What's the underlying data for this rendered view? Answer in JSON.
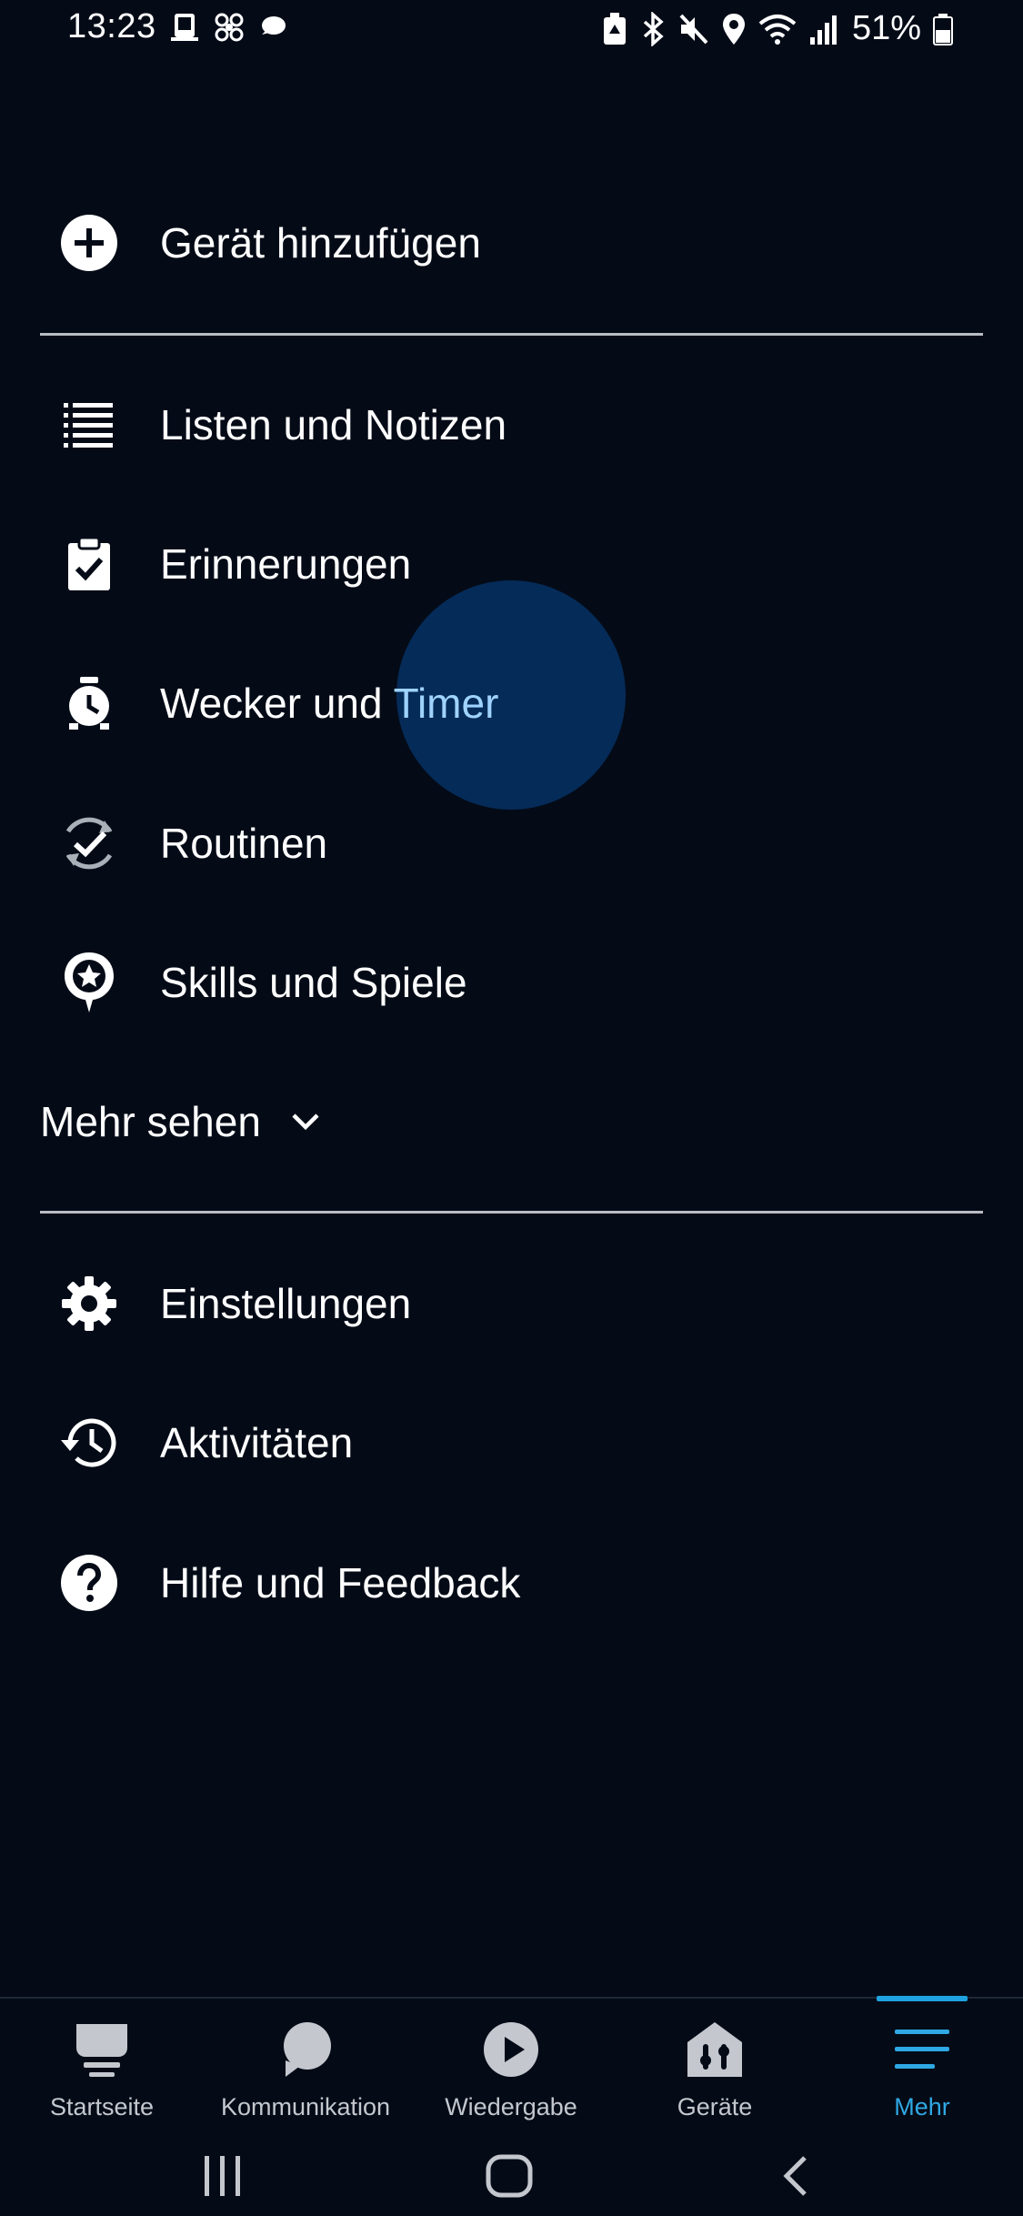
{
  "status_bar": {
    "time": "13:23",
    "battery_text": "51%",
    "left_icons": [
      "notification-app-icon",
      "notification-fan-icon",
      "notification-chat-icon"
    ],
    "right_icons": [
      "battery-saver-icon",
      "bluetooth-icon",
      "mute-icon",
      "location-icon",
      "wifi-icon",
      "signal-icon",
      "battery-icon"
    ]
  },
  "menu": {
    "add_device": {
      "label": "Gerät hinzufügen",
      "icon": "add-circle-icon"
    },
    "lists": {
      "label": "Listen und Notizen",
      "icon": "list-icon"
    },
    "reminders": {
      "label": "Erinnerungen",
      "icon": "clipboard-check-icon"
    },
    "alarms": {
      "label_part1": "Wecker und ",
      "label_part2": "Timer",
      "icon": "alarm-clock-icon"
    },
    "routines": {
      "label": "Routinen",
      "icon": "routine-icon"
    },
    "skills": {
      "label": "Skills und Spiele",
      "icon": "skills-icon"
    },
    "see_more": {
      "label": "Mehr sehen",
      "icon": "chevron-down-icon"
    },
    "settings": {
      "label": "Einstellungen",
      "icon": "gear-icon"
    },
    "activity": {
      "label": "Aktivitäten",
      "icon": "history-icon"
    },
    "help": {
      "label": "Hilfe und Feedback",
      "icon": "help-icon"
    }
  },
  "bottom_nav": {
    "items": [
      {
        "label": "Startseite",
        "icon": "home-icon"
      },
      {
        "label": "Kommunikation",
        "icon": "chat-bubble-icon"
      },
      {
        "label": "Wiedergabe",
        "icon": "play-icon"
      },
      {
        "label": "Geräte",
        "icon": "devices-icon"
      },
      {
        "label": "Mehr",
        "icon": "menu-icon",
        "active": true
      }
    ]
  },
  "colors": {
    "background": "#040b17",
    "accent": "#2fa8e4",
    "ripple": "#052c5b"
  }
}
